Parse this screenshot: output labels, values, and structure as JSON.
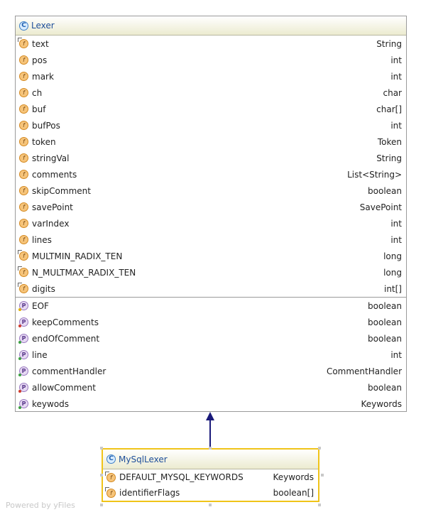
{
  "lexer": {
    "title": "Lexer",
    "class_icon": "C",
    "fields": [
      {
        "name": "text",
        "type": "String",
        "final": true
      },
      {
        "name": "pos",
        "type": "int",
        "final": false
      },
      {
        "name": "mark",
        "type": "int",
        "final": false
      },
      {
        "name": "ch",
        "type": "char",
        "final": false
      },
      {
        "name": "buf",
        "type": "char[]",
        "final": false
      },
      {
        "name": "bufPos",
        "type": "int",
        "final": false
      },
      {
        "name": "token",
        "type": "Token",
        "final": false
      },
      {
        "name": "stringVal",
        "type": "String",
        "final": false
      },
      {
        "name": "comments",
        "type": "List<String>",
        "final": false
      },
      {
        "name": "skipComment",
        "type": "boolean",
        "final": false
      },
      {
        "name": "savePoint",
        "type": "SavePoint",
        "final": false
      },
      {
        "name": "varIndex",
        "type": "int",
        "final": false
      },
      {
        "name": "lines",
        "type": "int",
        "final": false
      },
      {
        "name": "MULTMIN_RADIX_TEN",
        "type": "long",
        "final": true
      },
      {
        "name": "N_MULTMAX_RADIX_TEN",
        "type": "long",
        "final": true
      },
      {
        "name": "digits",
        "type": "int[]",
        "final": true
      }
    ],
    "properties": [
      {
        "name": "EOF",
        "type": "boolean",
        "dot": "#e0b000"
      },
      {
        "name": "keepComments",
        "type": "boolean",
        "dot": "#d03a2a"
      },
      {
        "name": "endOfComment",
        "type": "boolean",
        "dot": "#3aa040"
      },
      {
        "name": "line",
        "type": "int",
        "dot": "#3aa040"
      },
      {
        "name": "commentHandler",
        "type": "CommentHandler",
        "dot": "#3aa040"
      },
      {
        "name": "allowComment",
        "type": "boolean",
        "dot": "#d03a2a"
      },
      {
        "name": "keywods",
        "type": "Keywords",
        "dot": "#3aa040"
      }
    ]
  },
  "mysql": {
    "title": "MySqlLexer",
    "class_icon": "C",
    "fields": [
      {
        "name": "DEFAULT_MYSQL_KEYWORDS",
        "type": "Keywords",
        "final": true
      },
      {
        "name": "identifierFlags",
        "type": "boolean[]",
        "final": true
      }
    ]
  },
  "icons": {
    "field": "f",
    "property": "P"
  },
  "watermark": "Powered by yFiles",
  "colors": {
    "selection": "#f0c419",
    "arrow": "#1a1a7a",
    "class_title": "#1f4f9a"
  }
}
